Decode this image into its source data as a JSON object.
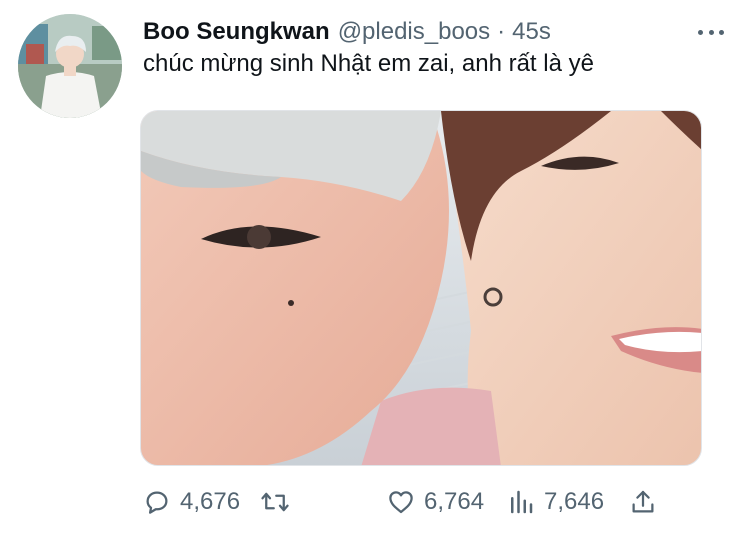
{
  "tweet": {
    "author_name": "Boo Seungkwan",
    "handle": "@pledis_boos",
    "separator": "·",
    "time": "45s",
    "text": "chúc mừng sinh Nhật em zai, anh rất là yê"
  },
  "icons": {
    "more": "more-dots-icon",
    "reply": "reply-bubble-icon",
    "retweet": "retweet-icon",
    "like": "heart-icon",
    "views": "bar-chart-icon",
    "share": "share-upload-icon"
  },
  "actions": {
    "reply_count": "4,676",
    "like_count": "6,764",
    "views_count": "7,646"
  },
  "colors": {
    "text": "#0f1419",
    "secondary": "#536471"
  }
}
